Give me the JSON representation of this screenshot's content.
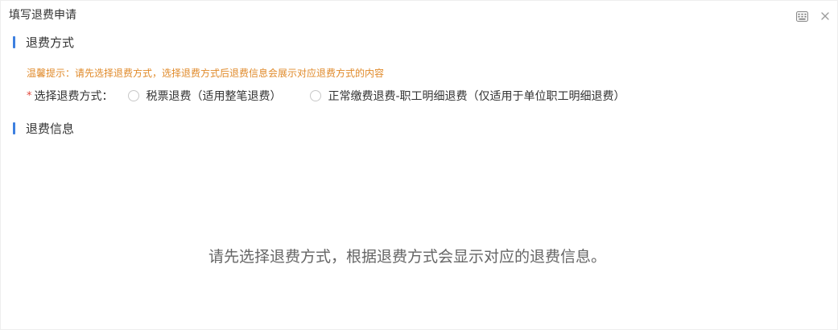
{
  "dialog": {
    "title": "填写退费申请"
  },
  "icons": {
    "keyboard": "keyboard-icon",
    "close": "close-icon"
  },
  "colors": {
    "accent": "#3d7fe0",
    "tip": "#e08a2a",
    "required": "#e2483d"
  },
  "method_section": {
    "title": "退费方式",
    "tip": "温馨提示：请先选择退费方式，选择退费方式后退费信息会展示对应退费方式的内容",
    "required_mark": "*",
    "label": "选择退费方式：",
    "options": [
      {
        "label": "税票退费（适用整笔退费）",
        "selected": false
      },
      {
        "label": "正常缴费退费-职工明细退费（仅适用于单位职工明细退费）",
        "selected": false
      }
    ]
  },
  "info_section": {
    "title": "退费信息",
    "empty_message": "请先选择退费方式，根据退费方式会显示对应的退费信息。"
  }
}
